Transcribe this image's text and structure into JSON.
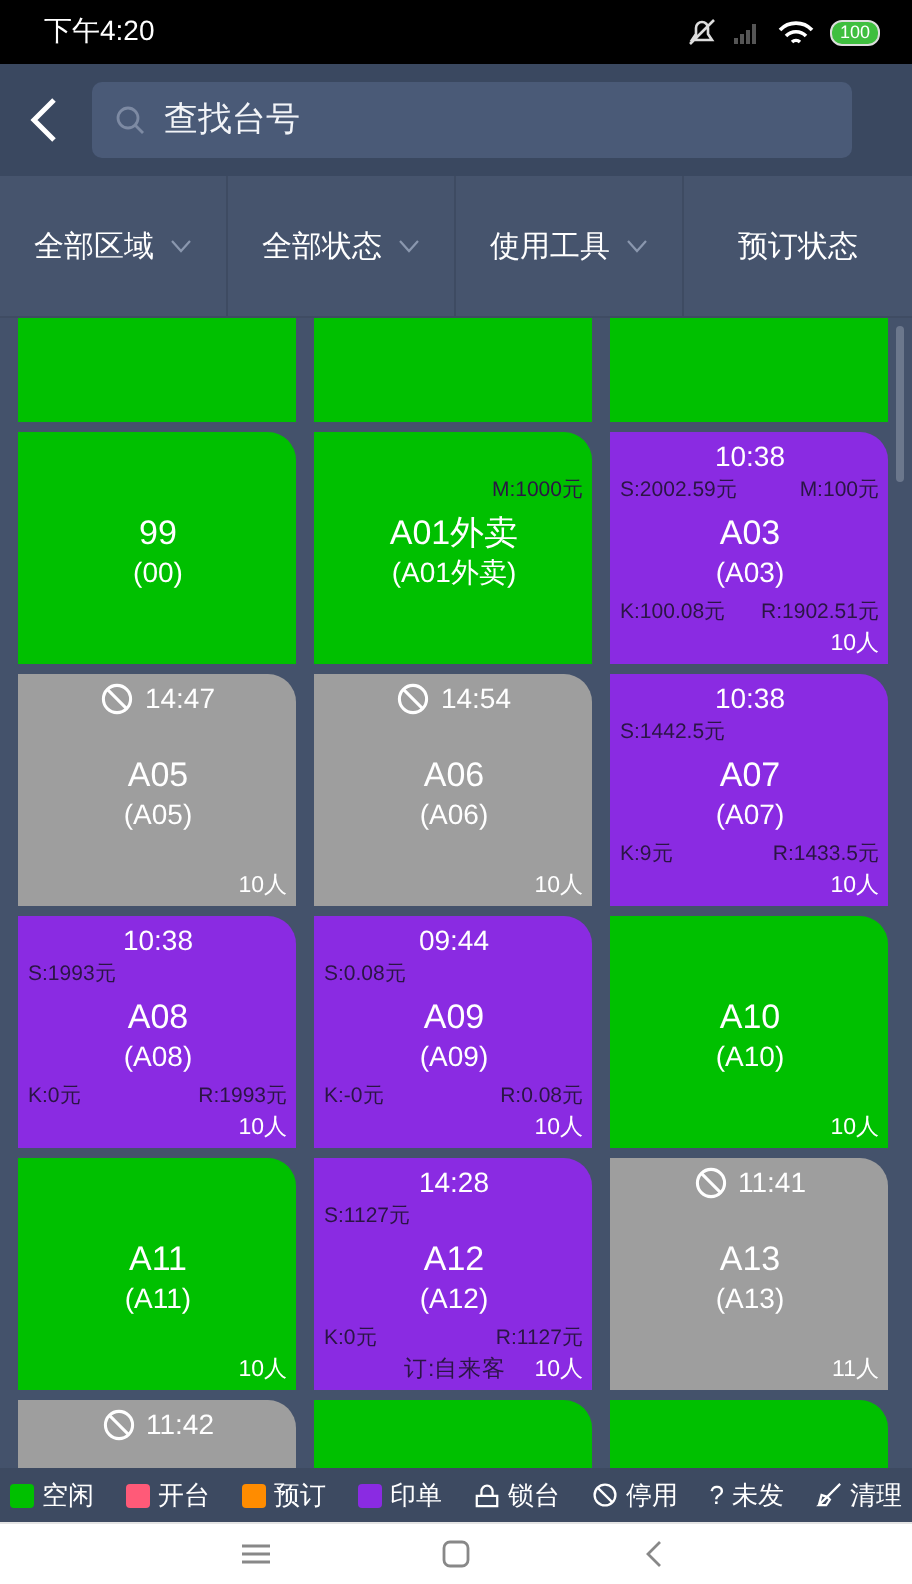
{
  "status_bar": {
    "time": "下午4:20",
    "battery": "100"
  },
  "header": {
    "search": {
      "placeholder": "查找台号"
    }
  },
  "filters": [
    {
      "label": "全部区域",
      "dropdown": true
    },
    {
      "label": "全部状态",
      "dropdown": true
    },
    {
      "label": "使用工具",
      "dropdown": true
    },
    {
      "label": "预订状态",
      "dropdown": false
    }
  ],
  "tables": [
    {
      "kind": "idle",
      "color": "#00c000"
    },
    {
      "kind": "idle",
      "color": "#00c000"
    },
    {
      "kind": "idle",
      "color": "#00c000"
    },
    {
      "kind": "idle",
      "color": "#00c000",
      "name": "99",
      "code": "(00)"
    },
    {
      "kind": "idle",
      "color": "#00c000",
      "m": "M:1000元",
      "name": "A01外卖",
      "code": "(A01外卖)"
    },
    {
      "kind": "printed",
      "color": "#8a2be2",
      "time": "10:38",
      "s": "S:2002.59元",
      "m": "M:100元",
      "name": "A03",
      "code": "(A03)",
      "k": "K:100.08元",
      "r": "R:1902.51元",
      "people": "10人"
    },
    {
      "kind": "disabled",
      "color": "#9e9e9e",
      "time": "14:47",
      "name": "A05",
      "code": "(A05)",
      "people": "10人"
    },
    {
      "kind": "disabled",
      "color": "#9e9e9e",
      "time": "14:54",
      "name": "A06",
      "code": "(A06)",
      "people": "10人"
    },
    {
      "kind": "printed",
      "color": "#8a2be2",
      "time": "10:38",
      "s": "S:1442.5元",
      "name": "A07",
      "code": "(A07)",
      "k": "K:9元",
      "r": "R:1433.5元",
      "people": "10人"
    },
    {
      "kind": "printed",
      "color": "#8a2be2",
      "time": "10:38",
      "s": "S:1993元",
      "name": "A08",
      "code": "(A08)",
      "k": "K:0元",
      "r": "R:1993元",
      "people": "10人"
    },
    {
      "kind": "printed",
      "color": "#8a2be2",
      "time": "09:44",
      "s": "S:0.08元",
      "name": "A09",
      "code": "(A09)",
      "k": "K:-0元",
      "r": "R:0.08元",
      "people": "10人"
    },
    {
      "kind": "idle",
      "color": "#00c000",
      "name": "A10",
      "code": "(A10)",
      "people": "10人"
    },
    {
      "kind": "idle",
      "color": "#00c000",
      "name": "A11",
      "code": "(A11)",
      "people": "10人"
    },
    {
      "kind": "printed",
      "color": "#8a2be2",
      "time": "14:28",
      "s": "S:1127元",
      "name": "A12",
      "code": "(A12)",
      "k": "K:0元",
      "r": "R:1127元",
      "note": "订:自来客",
      "people": "10人"
    },
    {
      "kind": "disabled",
      "color": "#9e9e9e",
      "time": "11:41",
      "name": "A13",
      "code": "(A13)",
      "people": "11人"
    },
    {
      "kind": "disabled",
      "color": "#9e9e9e",
      "time": "11:42"
    },
    {
      "kind": "idle",
      "color": "#00c000"
    },
    {
      "kind": "idle",
      "color": "#00c000"
    }
  ],
  "legend": [
    {
      "kind": "swatch",
      "label": "空闲",
      "color": "#00c000"
    },
    {
      "kind": "swatch",
      "label": "开台",
      "color": "#ff5a78"
    },
    {
      "kind": "swatch",
      "label": "预订",
      "color": "#ff8c00"
    },
    {
      "kind": "swatch",
      "label": "印单",
      "color": "#8a2be2"
    },
    {
      "kind": "lock",
      "label": "锁台"
    },
    {
      "kind": "ban",
      "label": "停用"
    },
    {
      "kind": "question",
      "symbol": "?",
      "label": "未发"
    },
    {
      "kind": "sweep",
      "label": "清理"
    }
  ]
}
